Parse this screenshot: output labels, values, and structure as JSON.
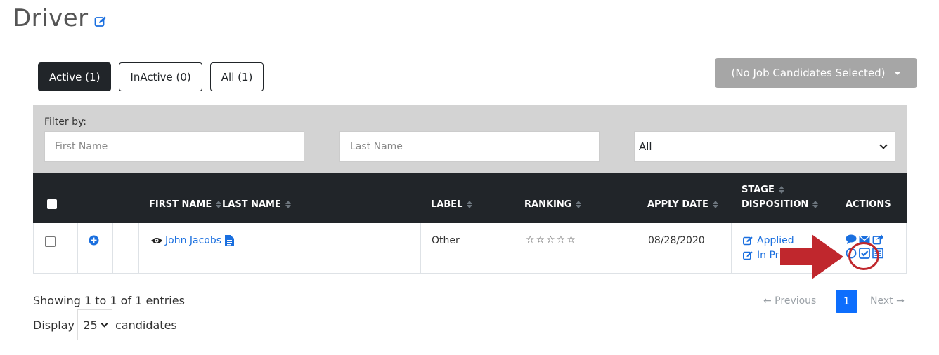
{
  "page": {
    "title": "Driver"
  },
  "tabs": [
    {
      "label": "Active (1)",
      "active": true
    },
    {
      "label": "InActive (0)",
      "active": false
    },
    {
      "label": "All (1)",
      "active": false
    }
  ],
  "job_select": {
    "label": "(No Job Candidates Selected)"
  },
  "filter": {
    "label": "Filter by:",
    "first_name_placeholder": "First Name",
    "last_name_placeholder": "Last Name",
    "select_value": "All"
  },
  "table": {
    "headers": {
      "first_name": "FIRST NAME",
      "last_name": "LAST NAME",
      "label": "LABEL",
      "ranking": "RANKING",
      "apply_date": "APPLY DATE",
      "stage": "STAGE",
      "disposition": "DISPOSITION",
      "actions": "ACTIONS"
    },
    "rows": [
      {
        "name": "John Jacobs",
        "label": "Other",
        "ranking": "☆☆☆☆☆",
        "apply_date": "08/28/2020",
        "stage": "Applied",
        "disposition": "In Pr"
      }
    ]
  },
  "footer": {
    "showing": "Showing 1 to 1 of 1 entries",
    "display_prefix": "Display",
    "display_value": "25",
    "display_suffix": "candidates"
  },
  "pagination": {
    "previous": "← Previous",
    "current_page": "1",
    "next": "Next →"
  },
  "colors": {
    "dark": "#212529",
    "link": "#1a6fdf",
    "primary": "#0d6efd",
    "annotation": "#c0272d",
    "filter_bg": "#d3d3d3"
  }
}
